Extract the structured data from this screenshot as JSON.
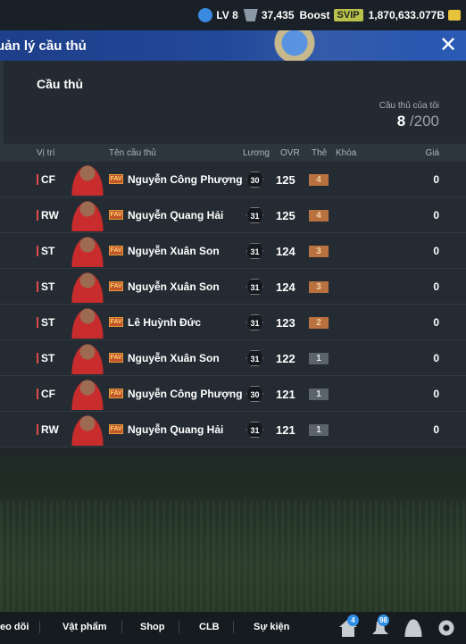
{
  "topbar": {
    "level": "LV 8",
    "points": "37,435",
    "boost_label": "Boost",
    "svip_label": "SVIP",
    "balance": "1,870,633.077B"
  },
  "header": {
    "title": "uản lý cầu thủ"
  },
  "section": {
    "title": "Cầu thủ",
    "count_label": "Cầu thủ của tôi",
    "count_current": "8",
    "count_max": "/200"
  },
  "table": {
    "headers": {
      "position": "Vị trí",
      "name": "Tên cầu thủ",
      "salary": "Lương",
      "ovr": "OVR",
      "grade": "Thẻ",
      "lock": "Khóa",
      "price": "Giá"
    },
    "rows": [
      {
        "position": "CF",
        "season": "FAV",
        "name": "Nguyễn Công Phượng",
        "salary": "30",
        "ovr": "125",
        "grade": "4",
        "grade_color": "orange",
        "price": "0"
      },
      {
        "position": "RW",
        "season": "FAV",
        "name": "Nguyễn Quang Hải",
        "salary": "31",
        "ovr": "125",
        "grade": "4",
        "grade_color": "orange",
        "price": "0"
      },
      {
        "position": "ST",
        "season": "FAV",
        "name": "Nguyễn Xuân Son",
        "salary": "31",
        "ovr": "124",
        "grade": "3",
        "grade_color": "orange",
        "price": "0"
      },
      {
        "position": "ST",
        "season": "FAV",
        "name": "Nguyễn Xuân Son",
        "salary": "31",
        "ovr": "124",
        "grade": "3",
        "grade_color": "orange",
        "price": "0"
      },
      {
        "position": "ST",
        "season": "FAV",
        "name": "Lê Huỳnh Đức",
        "salary": "31",
        "ovr": "123",
        "grade": "2",
        "grade_color": "orange",
        "price": "0"
      },
      {
        "position": "ST",
        "season": "FAV",
        "name": "Nguyễn Xuân Son",
        "salary": "31",
        "ovr": "122",
        "grade": "1",
        "grade_color": "gray",
        "price": "0"
      },
      {
        "position": "CF",
        "season": "FAV",
        "name": "Nguyễn Công Phượng",
        "salary": "30",
        "ovr": "121",
        "grade": "1",
        "grade_color": "gray",
        "price": "0"
      },
      {
        "position": "RW",
        "season": "FAV",
        "name": "Nguyễn Quang Hải",
        "salary": "31",
        "ovr": "121",
        "grade": "1",
        "grade_color": "gray",
        "price": "0"
      }
    ]
  },
  "bottom_nav": {
    "items": [
      "eo dõi",
      "Vật phẩm",
      "Shop",
      "CLB",
      "Sự kiện"
    ],
    "home_badge": "4",
    "notif_badge": "98"
  },
  "colors": {
    "title_bar": "#234a9c",
    "grade_orange": "#b9713f",
    "grade_gray": "#5b636b",
    "position_marker": "#e04a4a"
  }
}
